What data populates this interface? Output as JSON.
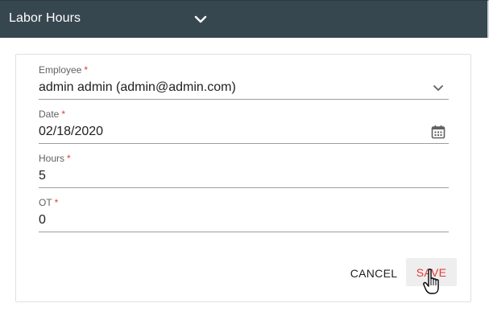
{
  "header": {
    "title": "Labor Hours",
    "chevron_icon": "chevron-down-icon"
  },
  "form": {
    "employee": {
      "label": "Employee",
      "required_mark": "*",
      "value": "admin admin (admin@admin.com)",
      "icon": "chevron-down-icon"
    },
    "date": {
      "label": "Date",
      "required_mark": "*",
      "value": "02/18/2020",
      "icon": "calendar-icon"
    },
    "hours": {
      "label": "Hours",
      "required_mark": "*",
      "value": "5"
    },
    "ot": {
      "label": "OT",
      "required_mark": "*",
      "value": "0"
    }
  },
  "actions": {
    "cancel_label": "CANCEL",
    "save_label": "SAVE"
  },
  "colors": {
    "header_bg": "#37474f",
    "accent": "#e53935"
  }
}
